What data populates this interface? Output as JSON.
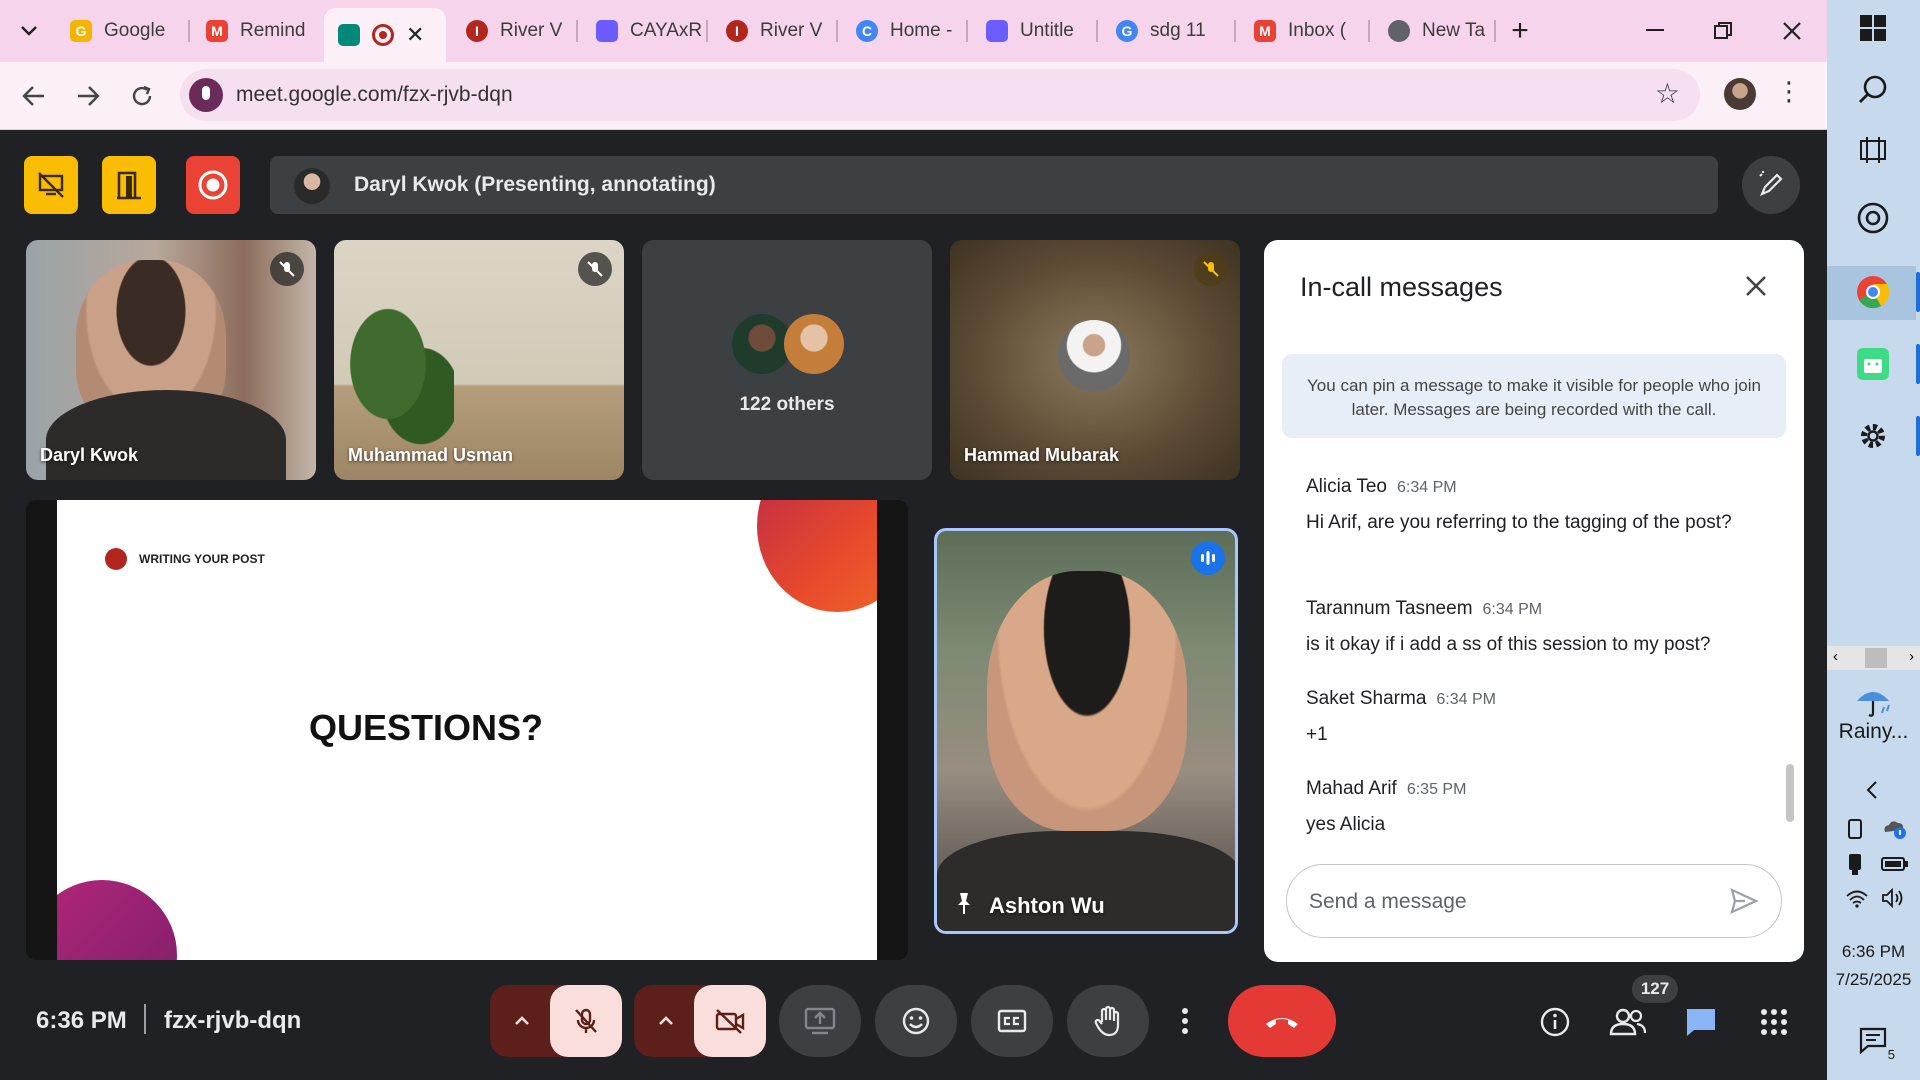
{
  "browser": {
    "tabs": [
      {
        "label": "Google",
        "fav_color": "#f4b400",
        "fav_char": "G"
      },
      {
        "label": "Remind",
        "fav_color": "#ea4335",
        "fav_char": "M"
      },
      {
        "label": "",
        "fav_color": "#00897b",
        "fav_char": "",
        "active": true
      },
      {
        "label": "River V",
        "fav_color": "#b3261e",
        "fav_char": "I"
      },
      {
        "label": "CAYAxR",
        "fav_color": "#6a5cff",
        "fav_char": ""
      },
      {
        "label": "River V",
        "fav_color": "#b3261e",
        "fav_char": "I"
      },
      {
        "label": "Home -",
        "fav_color": "#4285f4",
        "fav_char": "C"
      },
      {
        "label": "Untitle",
        "fav_color": "#6a5cff",
        "fav_char": ""
      },
      {
        "label": "sdg 11",
        "fav_color": "#4285f4",
        "fav_char": "G"
      },
      {
        "label": "Inbox (",
        "fav_color": "#ea4335",
        "fav_char": "M"
      },
      {
        "label": "New Ta",
        "fav_color": "#5f6368",
        "fav_char": ""
      }
    ],
    "url": "meet.google.com/fzx-rjvb-dqn"
  },
  "meet": {
    "presenter_text": "Daryl Kwok (Presenting, annotating)",
    "tiles": [
      {
        "name": "Daryl Kwok"
      },
      {
        "name": "Muhammad Usman"
      },
      {
        "name": "122 others"
      },
      {
        "name": "Hammad Mubarak"
      }
    ],
    "slide": {
      "header": "WRITING YOUR POST",
      "heading": "QUESTIONS?"
    },
    "speaker": {
      "name": "Ashton Wu"
    },
    "clock": "6:36 PM",
    "meeting_code": "fzx-rjvb-dqn",
    "participant_count": "127"
  },
  "chat": {
    "title": "In-call messages",
    "info": "You can pin a message to make it visible for people who join later. Messages are being recorded with the call.",
    "messages": [
      {
        "sender": "Alicia Teo",
        "time": "6:34 PM",
        "text": "Hi Arif, are you referring to the tagging of the post?"
      },
      {
        "sender": "Tarannum Tasneem",
        "time": "6:34 PM",
        "text": "is it okay if i add a ss of this session to my post?"
      },
      {
        "sender": "Saket Sharma",
        "time": "6:34 PM",
        "text": "+1"
      },
      {
        "sender": "Mahad Arif",
        "time": "6:35 PM",
        "text": "yes Alicia"
      }
    ],
    "input_placeholder": "Send a message"
  },
  "taskbar": {
    "weather": "Rainy...",
    "time": "6:36 PM",
    "date": "7/25/2025",
    "notification_count": "5"
  },
  "colors": {
    "tabbar_bg": "#f6d4ec",
    "meet_bg": "#202124",
    "leave_red": "#e53935",
    "speaker_border": "#a8c7fa",
    "warning_yellow": "#fbbc04"
  }
}
